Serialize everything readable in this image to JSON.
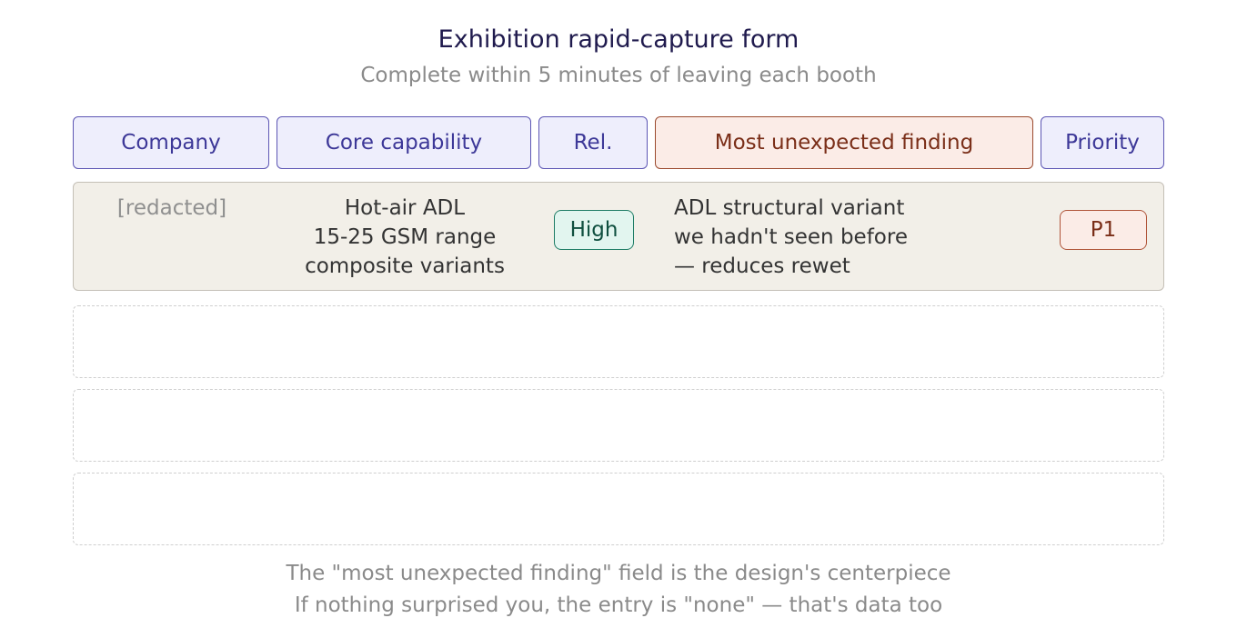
{
  "header": {
    "title": "Exhibition rapid-capture form",
    "subtitle": "Complete within 5 minutes of leaving each booth"
  },
  "columns": {
    "company": "Company",
    "capability": "Core capability",
    "relevance": "Rel.",
    "finding": "Most unexpected finding",
    "priority": "Priority"
  },
  "entry": {
    "company": "[redacted]",
    "capability_lines": [
      "Hot-air ADL",
      "15-25 GSM range",
      "composite variants"
    ],
    "relevance": "High",
    "finding_lines": [
      "ADL structural variant",
      "we hadn't seen before",
      "— reduces rewet"
    ],
    "priority": "P1"
  },
  "footer": {
    "note1": "The \"most unexpected finding\" field is the design's centerpiece",
    "note2": "If nothing surprised you, the entry is \"none\" — that's data too"
  },
  "colors": {
    "header_fill": "#eeeefc",
    "header_border": "#5d56b4",
    "accent_fill": "#fbece7",
    "accent_border": "#9b4a2e",
    "row_fill": "#f2efe8",
    "high_fill": "#e2f5ef",
    "high_border": "#1d7c65"
  }
}
